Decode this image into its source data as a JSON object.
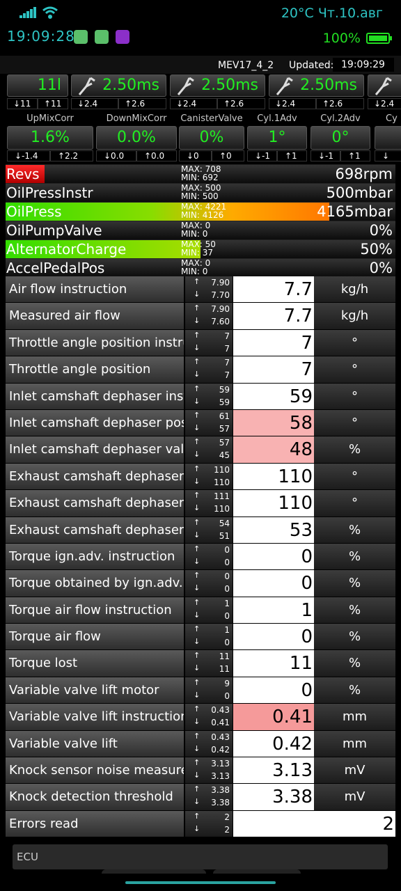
{
  "status": {
    "time": "19:09:28",
    "weather": "20°C",
    "date": "Чт.10.авг",
    "battery": "100%",
    "icons": [
      "signal-icon",
      "wifi-icon",
      "android-app-icon",
      "android-app-icon",
      "game-app-icon",
      "battery-icon"
    ]
  },
  "header": {
    "ecu": "MEV17_4_2",
    "updated_label": "Updated:",
    "updated_time": "19:09:29"
  },
  "top_gauges": [
    {
      "value": "11l",
      "min": "↓11",
      "max": "↑11",
      "icon": null
    },
    {
      "value": "2.50ms",
      "min": "↓2.4",
      "max": "↑2.6",
      "icon": "injector-icon"
    },
    {
      "value": "2.50ms",
      "min": "↓2.4",
      "max": "↑2.6",
      "icon": "injector-icon"
    },
    {
      "value": "2.50ms",
      "min": "↓2.4",
      "max": "↑2.6",
      "icon": "injector-icon"
    },
    {
      "value": "",
      "min": "↓2.4",
      "max": "",
      "icon": "injector-icon"
    }
  ],
  "mid_gauges": [
    {
      "label": "UpMixCorr",
      "value": "1.6%",
      "min": "↓-1.4",
      "max": "↑2.2"
    },
    {
      "label": "DownMixCorr",
      "value": "0.0%",
      "min": "↓0.0",
      "max": "↑0.0"
    },
    {
      "label": "CanisterValve",
      "value": "0%",
      "min": "↓0",
      "max": "↑0"
    },
    {
      "label": "Cyl.1Adv",
      "value": "1°",
      "min": "↓-1",
      "max": "↑1"
    },
    {
      "label": "Cyl.2Adv",
      "value": "0°",
      "min": "↓-1",
      "max": "↑1"
    },
    {
      "label": "Cy",
      "value": "",
      "min": "↓",
      "max": ""
    }
  ],
  "bars": [
    {
      "name": "Revs",
      "max": "MAX: 708",
      "min": "MIN: 692",
      "value": "698rpm",
      "fill_pct": 10,
      "fill": "linear-gradient(#ff2a2a,#b00000)"
    },
    {
      "name": "OilPressInstr",
      "max": "MAX: 500",
      "min": "MIN: 500",
      "value": "500mbar",
      "fill_pct": 0,
      "fill": "none"
    },
    {
      "name": "OilPress",
      "max": "MAX: 4221",
      "min": "MIN: 4126",
      "value": "4165mbar",
      "fill_pct": 83,
      "fill": "linear-gradient(90deg,#33dd00 0%,#88dd00 45%,#ffaa00 70%,#ff7700 100%)"
    },
    {
      "name": "OilPumpValve",
      "max": "MAX: 0",
      "min": "MIN: 0",
      "value": "0%",
      "fill_pct": 0,
      "fill": "none"
    },
    {
      "name": "AlternatorCharge",
      "max": "MAX: 50",
      "min": "MIN: 37",
      "value": "50%",
      "fill_pct": 50,
      "fill": "linear-gradient(90deg,#33dd00,#aadd00)"
    },
    {
      "name": "AccelPedalPos",
      "max": "MAX: 0",
      "min": "MIN: 0",
      "value": "0%",
      "fill_pct": 0,
      "fill": "none"
    }
  ],
  "rows": [
    {
      "name": "Air flow instruction",
      "max": "7.90",
      "min": "7.70",
      "value": "7.7",
      "unit": "kg/h",
      "state": ""
    },
    {
      "name": "Measured air flow",
      "max": "7.90",
      "min": "7.60",
      "value": "7.7",
      "unit": "kg/h",
      "state": ""
    },
    {
      "name": "Throttle angle position instruction",
      "max": "7",
      "min": "7",
      "value": "7",
      "unit": "°",
      "state": ""
    },
    {
      "name": "Throttle angle position",
      "max": "7",
      "min": "7",
      "value": "7",
      "unit": "°",
      "state": ""
    },
    {
      "name": "Inlet camshaft dephaser instruction",
      "max": "59",
      "min": "59",
      "value": "59",
      "unit": "°",
      "state": ""
    },
    {
      "name": "Inlet camshaft dephaser position",
      "max": "61",
      "min": "57",
      "value": "58",
      "unit": "°",
      "state": "warn"
    },
    {
      "name": "Inlet camshaft dephaser valve",
      "max": "57",
      "min": "45",
      "value": "48",
      "unit": "%",
      "state": "warn"
    },
    {
      "name": "Exhaust camshaft dephaser instruction",
      "max": "110",
      "min": "110",
      "value": "110",
      "unit": "°",
      "state": ""
    },
    {
      "name": "Exhaust camshaft dephaser position",
      "max": "111",
      "min": "110",
      "value": "110",
      "unit": "°",
      "state": ""
    },
    {
      "name": "Exhaust camshaft dephaser valve",
      "max": "54",
      "min": "51",
      "value": "53",
      "unit": "%",
      "state": ""
    },
    {
      "name": "Torque ign.adv. instruction",
      "max": "0",
      "min": "0",
      "value": "0",
      "unit": "%",
      "state": ""
    },
    {
      "name": "Torque obtained by ign.adv.",
      "max": "0",
      "min": "0",
      "value": "0",
      "unit": "%",
      "state": ""
    },
    {
      "name": "Torque air flow instruction",
      "max": "1",
      "min": "0",
      "value": "1",
      "unit": "%",
      "state": ""
    },
    {
      "name": "Torque air flow",
      "max": "1",
      "min": "0",
      "value": "0",
      "unit": "%",
      "state": ""
    },
    {
      "name": "Torque lost",
      "max": "11",
      "min": "11",
      "value": "11",
      "unit": "%",
      "state": ""
    },
    {
      "name": "Variable valve lift motor",
      "max": "9",
      "min": "0",
      "value": "0",
      "unit": "%",
      "state": ""
    },
    {
      "name": "Variable valve lift instruction",
      "max": "0.43",
      "min": "0.41",
      "value": "0.41",
      "unit": "mm",
      "state": "alert"
    },
    {
      "name": "Variable valve lift",
      "max": "0.43",
      "min": "0.42",
      "value": "0.42",
      "unit": "mm",
      "state": ""
    },
    {
      "name": "Knock sensor noise measured",
      "max": "3.13",
      "min": "3.13",
      "value": "3.13",
      "unit": "mV",
      "state": ""
    },
    {
      "name": "Knock detection threshold",
      "max": "3.38",
      "min": "3.38",
      "value": "3.38",
      "unit": "mV",
      "state": ""
    },
    {
      "name": "Errors read",
      "max": "2",
      "min": "2",
      "value": "2",
      "unit": "",
      "state": "errors"
    }
  ],
  "footer": {
    "ecu_field": "ECU"
  }
}
